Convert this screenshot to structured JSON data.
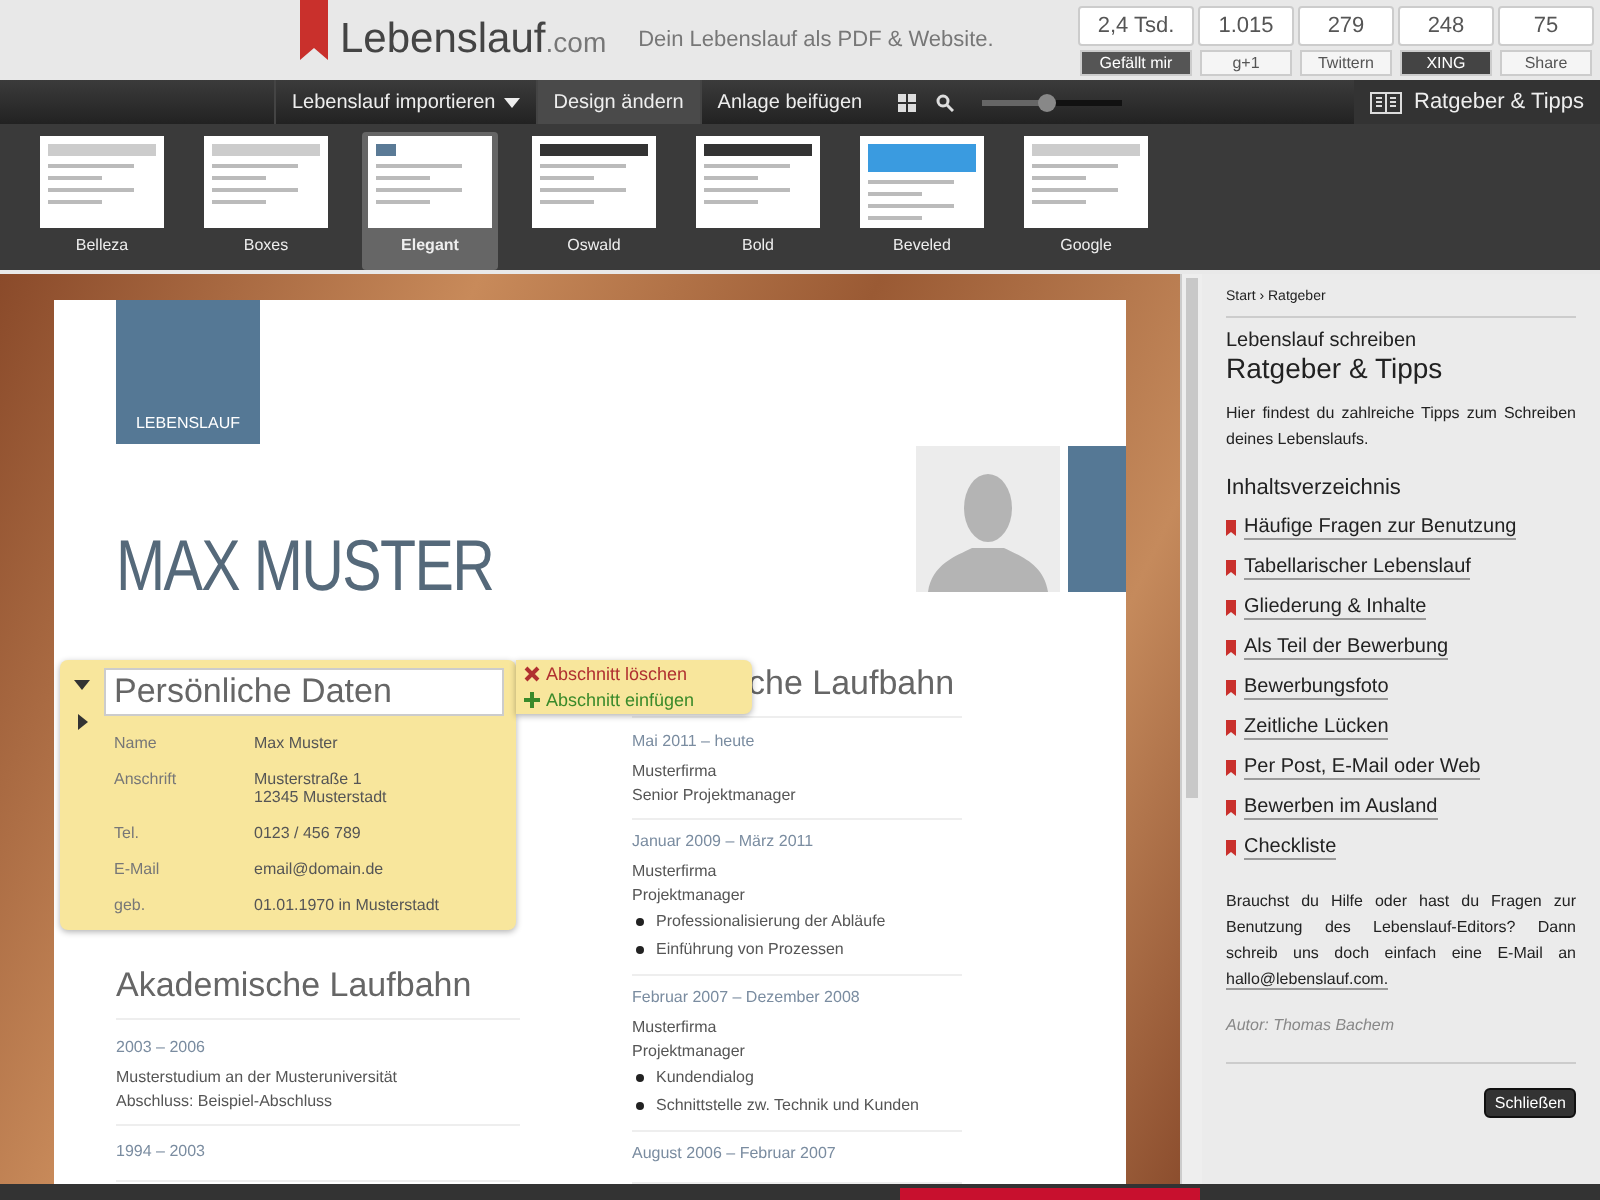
{
  "header": {
    "logo": "Lebenslauf",
    "logo_suffix": ".com",
    "tagline": "Dein Lebenslauf als PDF & Website.",
    "social": [
      {
        "count": "2,4 Tsd.",
        "button": "Gefällt mir",
        "kind": "facebook"
      },
      {
        "count": "1.015",
        "button": "g+1",
        "kind": "plus"
      },
      {
        "count": "279",
        "button": "Twittern",
        "kind": "twitter"
      },
      {
        "count": "248",
        "button": "XING",
        "kind": "xing"
      },
      {
        "count": "75",
        "button": "Share",
        "kind": "linkedin"
      }
    ]
  },
  "toolbar": {
    "items": [
      {
        "label": "Lebenslauf importieren",
        "selected": false,
        "dropdown": true
      },
      {
        "label": "Design ändern",
        "selected": true,
        "dropdown": false
      },
      {
        "label": "Anlage beifügen",
        "selected": false,
        "dropdown": false
      }
    ],
    "zoom": {
      "level": 0.45
    },
    "guide_button": "Ratgeber & Tipps"
  },
  "designs": [
    {
      "label": "Belleza",
      "selected": false
    },
    {
      "label": "Boxes",
      "selected": false
    },
    {
      "label": "Elegant",
      "selected": true
    },
    {
      "label": "Oswald",
      "selected": false
    },
    {
      "label": "Bold",
      "selected": false
    },
    {
      "label": "Beveled",
      "selected": false
    },
    {
      "label": "Google",
      "selected": false
    }
  ],
  "resume": {
    "badge": "LEBENSLAUF",
    "name": "MAX MUSTER",
    "active_section": {
      "title": "Persönliche Daten",
      "actions": [
        {
          "label": "Abschnitt löschen",
          "kind": "delete"
        },
        {
          "label": "Abschnitt einfügen",
          "kind": "add"
        }
      ],
      "rows": [
        {
          "label": "Name",
          "value": "Max Muster"
        },
        {
          "label": "Anschrift",
          "value": "Musterstraße 1\n12345 Musterstadt"
        },
        {
          "label": "Tel.",
          "value": "0123 / 456 789"
        },
        {
          "label": "E-Mail",
          "value": "email@domain.de"
        },
        {
          "label": "geb.",
          "value": "01.01.1970 in Musterstadt"
        }
      ]
    },
    "left_sections": [
      {
        "title": "Akademische Laufbahn",
        "entries": [
          {
            "date": "2003 – 2006",
            "lines": [
              "Musterstudium an der Musteruniversität",
              "Abschluss: Beispiel-Abschluss"
            ]
          },
          {
            "date": "1994 – 2003"
          }
        ]
      }
    ],
    "right_section": {
      "title": "che Laufbahn",
      "entries": [
        {
          "date": "Mai 2011 – heute",
          "lines": [
            "Musterfirma",
            "Senior Projektmanager"
          ]
        },
        {
          "date": "Januar 2009 – März 2011",
          "lines": [
            "Musterfirma",
            "Projektmanager"
          ],
          "bullets": [
            "Professionalisierung der Abläufe",
            "Einführung von Prozessen"
          ]
        },
        {
          "date": "Februar 2007 – Dezember 2008",
          "lines": [
            "Musterfirma",
            "Projektmanager"
          ],
          "bullets": [
            "Kundendialog",
            "Schnittstelle zw. Technik und Kunden"
          ]
        },
        {
          "date": "August 2006 – Februar 2007"
        }
      ]
    }
  },
  "guide": {
    "breadcrumb": "Start › Ratgeber",
    "kicker": "Lebenslauf schreiben",
    "title": "Ratgeber & Tipps",
    "intro": "Hier findest du zahlreiche Tipps zum Schreiben deines Lebenslaufs.",
    "toc_title": "Inhaltsverzeichnis",
    "links": [
      "Häufige Fragen zur Benutzung",
      "Tabellarischer Lebenslauf",
      "Gliederung & Inhalte",
      "Als Teil der Bewerbung",
      "Bewerbungsfoto",
      "Zeitliche Lücken",
      "Per Post, E-Mail oder Web",
      "Bewerben im Ausland",
      "Checkliste"
    ],
    "help_text": "Brauchst du Hilfe oder hast du Fragen zur Benutzung des Lebenslauf-Editors? Dann schreib uns doch einfach eine E-Mail an",
    "help_email": "hallo@lebenslauf.com.",
    "author": "Autor: Thomas Bachem",
    "close_button": "Schließen"
  }
}
